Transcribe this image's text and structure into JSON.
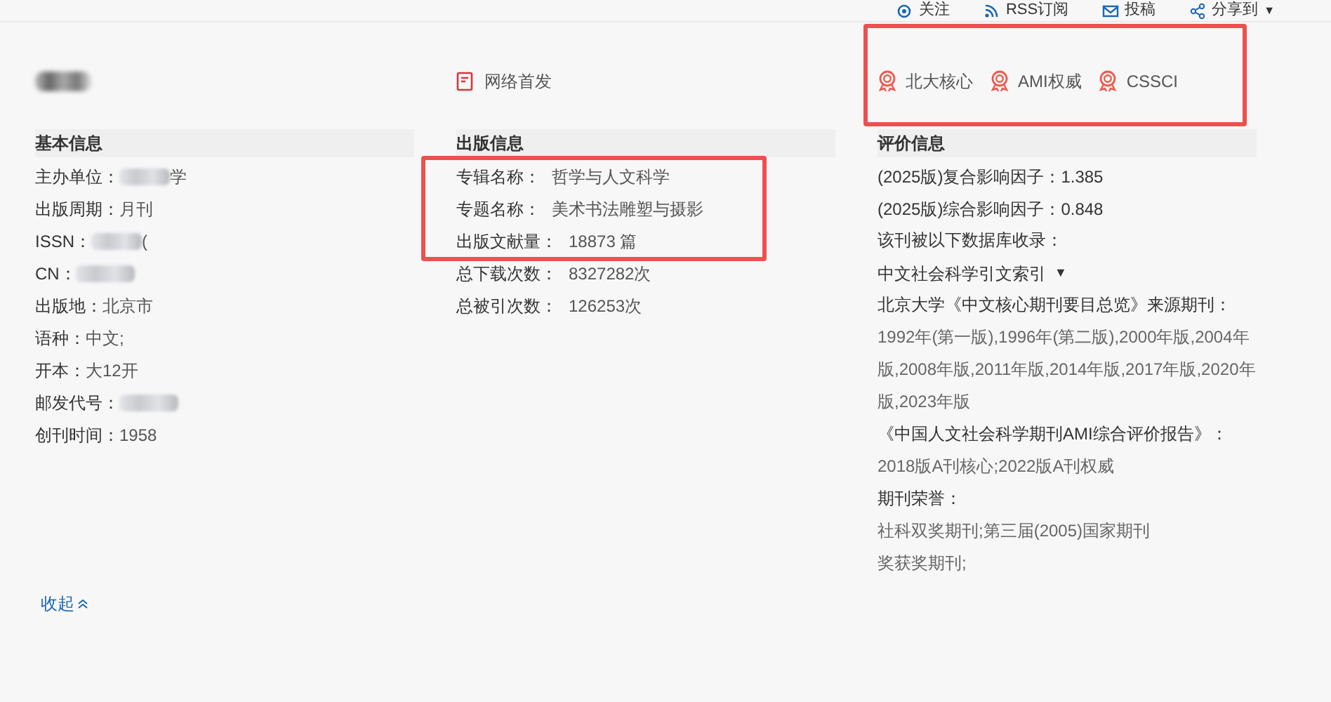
{
  "top_links": [
    {
      "label": "关注"
    },
    {
      "label": "RSS订阅"
    },
    {
      "label": "投稿"
    },
    {
      "label": "分享到",
      "caret": "▼"
    }
  ],
  "journal_title": {
    "blurred": true
  },
  "online_first": {
    "label": "网络首发"
  },
  "badges_highlighted": true,
  "badges": [
    {
      "label": "北大核心"
    },
    {
      "label": "AMI权威"
    },
    {
      "label": "CSSCI"
    }
  ],
  "basic_info": {
    "heading": "基本信息",
    "fields": [
      {
        "label": "主办单位：",
        "value": "学",
        "blurred": true
      },
      {
        "label": "出版周期：",
        "value": "月刊",
        "blurred": false
      },
      {
        "label": "ISSN：",
        "value": "(",
        "blurred": true
      },
      {
        "label": "CN：",
        "blurred": true
      },
      {
        "label": "出版地：",
        "value": "北京市",
        "blurred": false
      },
      {
        "label": "语种：",
        "value": "中文;",
        "blurred": false
      },
      {
        "label": "开本：",
        "value": "大12开",
        "blurred": false
      },
      {
        "label": "邮发代号：",
        "blurred": true
      },
      {
        "label": "创刊时间：",
        "value": "1958",
        "blurred": false
      }
    ]
  },
  "publication_info": {
    "heading": "出版信息",
    "fields": [
      {
        "label": "专辑名称：",
        "value": "哲学与人文科学",
        "highlighted": true
      },
      {
        "label": "专题名称：",
        "value": "美术书法雕塑与摄影",
        "highlighted": true
      },
      {
        "label": "出版文献量：",
        "value": "18873 篇",
        "highlighted": true
      },
      {
        "label": "总下载次数：",
        "value": "8327282次",
        "highlighted": false
      },
      {
        "label": "总被引次数：",
        "value": "126253次",
        "highlighted": false
      }
    ]
  },
  "evaluation_info": {
    "heading": "评价信息",
    "lines": [
      {
        "kind": "field",
        "label": "(2025版)复合影响因子：",
        "value": "1.385"
      },
      {
        "kind": "field",
        "label": "(2025版)综合影响因子：",
        "value": "0.848"
      },
      {
        "kind": "label",
        "text": "该刊被以下数据库收录："
      },
      {
        "kind": "dropdown",
        "text": "中文社会科学引文索引",
        "caret": "▼"
      },
      {
        "kind": "label",
        "text": "北京大学《中文核心期刊要目总览》来源期刊："
      },
      {
        "kind": "value",
        "text": "1992年(第一版),1996年(第二版),2000年版,2004年版,2008年版,2011年版,2014年版,2017年版,2020年版,2023年版"
      },
      {
        "kind": "label",
        "text": "《中国人文社会科学期刊AMI综合评价报告》："
      },
      {
        "kind": "value",
        "text": "2018版A刊核心;2022版A刊权威"
      },
      {
        "kind": "label",
        "text": "期刊荣誉："
      },
      {
        "kind": "honor",
        "text": "社科双奖期刊;第三届(2005)国家期刊奖获奖期刊;"
      }
    ]
  },
  "collapse_link": {
    "label": "收起"
  }
}
